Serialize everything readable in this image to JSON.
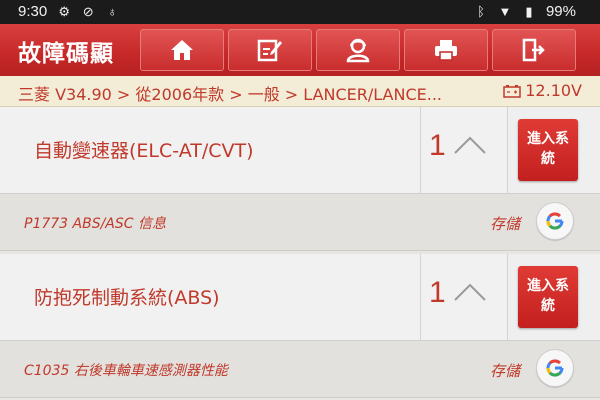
{
  "statusbar": {
    "time": "9:30",
    "battery": "99%"
  },
  "header": {
    "title": "故障碼顯",
    "buttons": [
      "home-icon",
      "edit-report-icon",
      "user-icon",
      "print-icon",
      "exit-icon"
    ]
  },
  "breadcrumb": {
    "path": "三菱 V34.90 > 從2006年款 > 一般 > LANCER/LANCE...",
    "voltage": "12.10V"
  },
  "systems": [
    {
      "name": "自動變速器(ELC-AT/CVT)",
      "count": "1",
      "enter_label_1": "進入系",
      "enter_label_2": "統",
      "dtc": {
        "code": "P1773 ABS/ASC 信息",
        "store": "存儲"
      }
    },
    {
      "name": "防抱死制動系統(ABS)",
      "count": "1",
      "enter_label_1": "進入系",
      "enter_label_2": "統",
      "dtc": {
        "code": "C1035 右後車輪車速感測器性能",
        "store": "存儲"
      }
    }
  ],
  "colors": {
    "brand_red": "#c62828",
    "text_red": "#c0392b"
  }
}
